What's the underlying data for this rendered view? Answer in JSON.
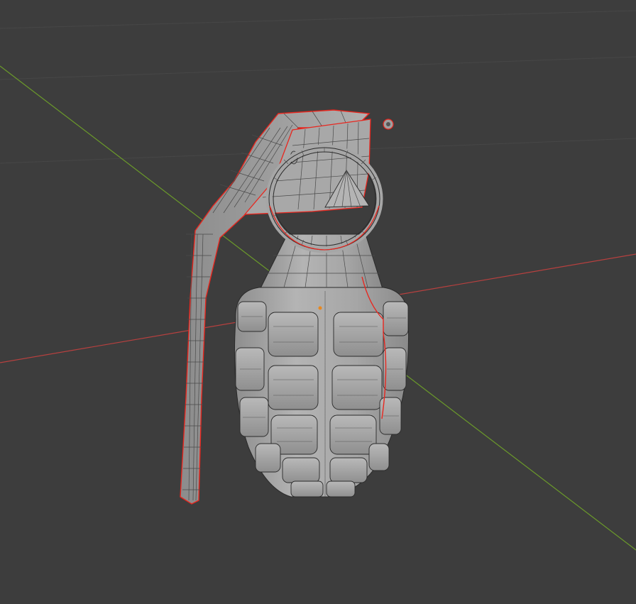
{
  "app": {
    "view": "3d-viewport",
    "mode": "edit-mode-wireframe-overlay"
  },
  "viewport": {
    "background_color": "#3d3d3d",
    "grid_line_color": "#474747",
    "x_axis_color": "#b8403f",
    "y_axis_color": "#6b9a2a"
  },
  "object": {
    "kind": "grenade-mesh",
    "surface_color": "#a3a3a3",
    "edge_color": "#2a2a2a",
    "seam_color": "#e8271f",
    "origin_color": "#e8871e"
  }
}
